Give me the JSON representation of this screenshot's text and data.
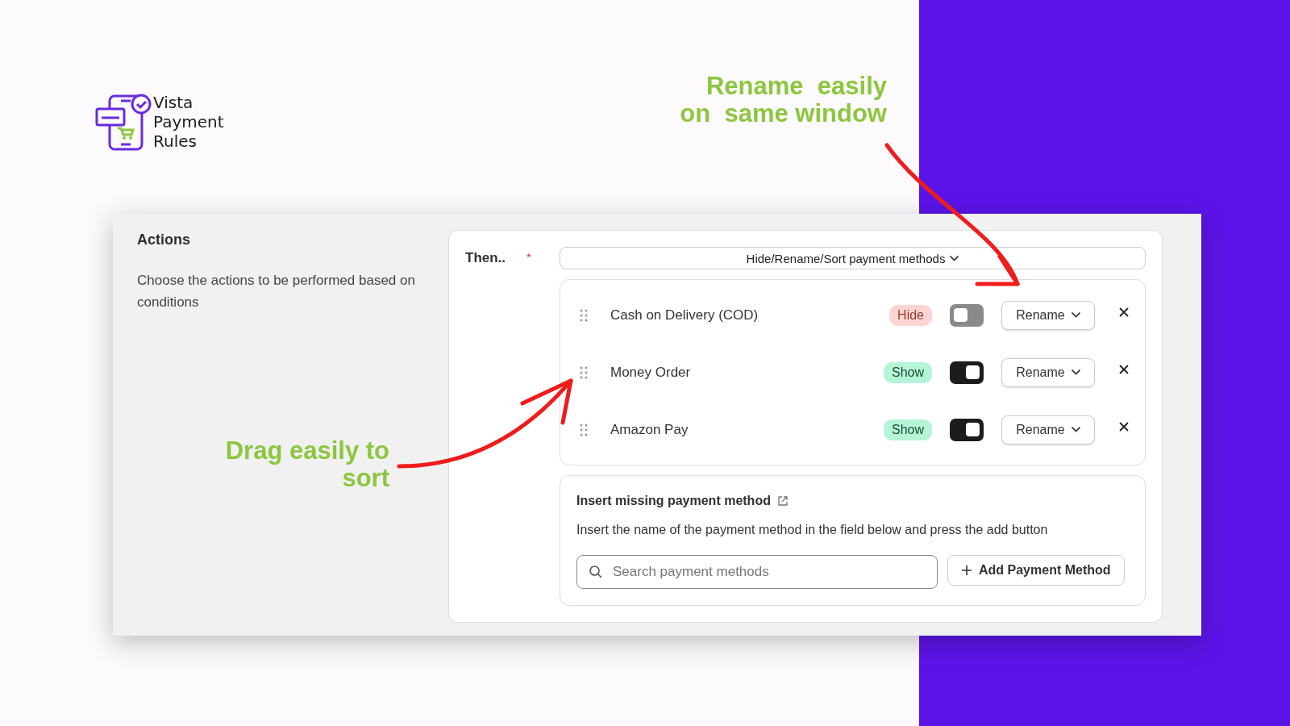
{
  "logo": {
    "lines": [
      "Vista",
      "Payment",
      "Rules"
    ]
  },
  "callouts": [
    {
      "lines": [
        "Rename  easily",
        "on  same window"
      ]
    },
    {
      "lines": [
        "Drag easily to",
        "sort"
      ]
    }
  ],
  "actions": {
    "title": "Actions",
    "description": "Choose the actions to be performed based on conditions"
  },
  "then": {
    "label": "Then..",
    "required_mark": "*",
    "select": {
      "value": "Hide/Rename/Sort payment methods"
    }
  },
  "methods": [
    {
      "name": "Cash on Delivery (COD)",
      "status": "Hide",
      "visible": false,
      "on": false,
      "rename": "Rename"
    },
    {
      "name": "Money Order",
      "status": "Show",
      "visible": true,
      "on": true,
      "rename": "Rename"
    },
    {
      "name": "Amazon Pay",
      "status": "Show",
      "visible": true,
      "on": true,
      "rename": "Rename"
    }
  ],
  "insert": {
    "title": "Insert missing payment method",
    "description": "Insert the name of the payment method in the field below and press the add button",
    "search": {
      "placeholder": "Search payment methods"
    },
    "button": "Add Payment Method"
  }
}
